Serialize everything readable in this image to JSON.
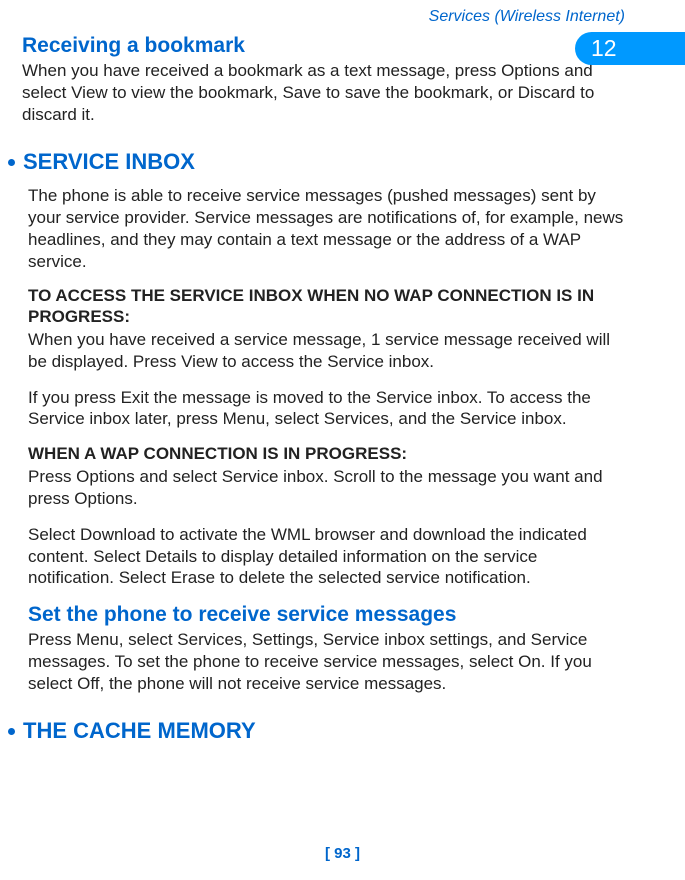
{
  "header": {
    "section_title": "Services (Wireless Internet)"
  },
  "chapter_number": "12",
  "sections": {
    "receiving_bookmark": {
      "heading": "Receiving a bookmark",
      "body": "When you have received a bookmark as a text message, press Options and select View to view the bookmark, Save to save the bookmark, or Discard to discard it."
    },
    "service_inbox": {
      "heading": "SERVICE INBOX",
      "intro": "The phone is able to receive service messages (pushed messages) sent by your service provider. Service messages are notifications of, for example, news headlines, and they may contain a text message or the address of a WAP service.",
      "sub1_heading": "TO ACCESS THE SERVICE INBOX WHEN NO WAP CONNECTION IS IN PROGRESS:",
      "sub1_body1": "When you have received a service message, 1 service message received will be displayed. Press View to access the Service inbox.",
      "sub1_body2": "If you press Exit the message is moved to the Service inbox. To access the Service inbox later, press Menu, select Services, and the Service inbox.",
      "sub2_heading": "WHEN A WAP CONNECTION IS IN PROGRESS:",
      "sub2_body1": "Press Options and select Service inbox. Scroll to the message you want and press Options.",
      "sub2_body2": "Select Download to activate the WML browser and download the indicated content. Select Details to display detailed information on the service notification. Select Erase to delete the selected service notification."
    },
    "set_phone_receive": {
      "heading": "Set the phone to receive service messages",
      "body": "Press Menu, select Services, Settings, Service inbox settings, and Service messages. To set the phone to receive service messages, select On. If you select Off, the phone will not receive service messages."
    },
    "cache_memory": {
      "heading": "THE CACHE MEMORY"
    }
  },
  "footer": {
    "page_number": "[ 93 ]"
  }
}
